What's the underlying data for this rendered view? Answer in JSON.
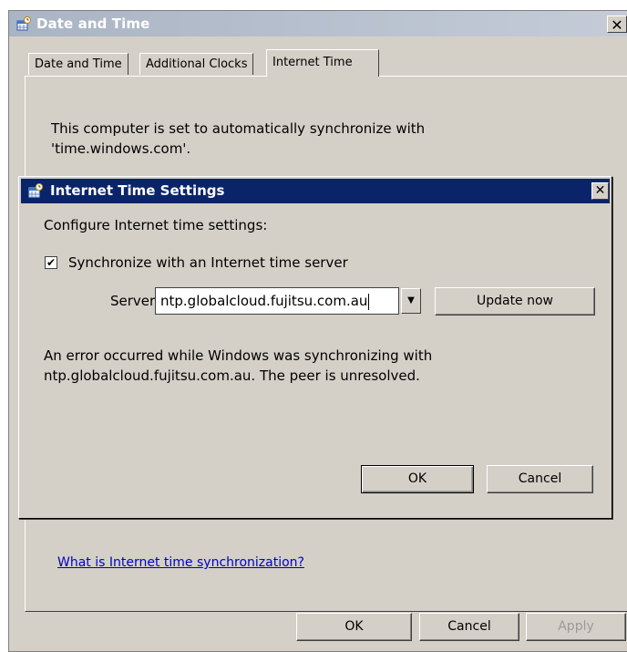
{
  "outer_window": {
    "title": "Date and Time",
    "close_label": "✕",
    "tabs": [
      {
        "label": "Date and Time"
      },
      {
        "label": "Additional Clocks"
      },
      {
        "label": "Internet Time"
      }
    ],
    "sync_status_line1": "This computer is set to automatically synchronize with",
    "sync_status_line2": "'time.windows.com'.",
    "help_link": "What is Internet time synchronization?",
    "ok_label": "OK",
    "cancel_label": "Cancel",
    "apply_label": "Apply"
  },
  "inner_dialog": {
    "title": "Internet Time Settings",
    "close_label": "✕",
    "configure_label": "Configure Internet time settings:",
    "sync_checkbox_label": "Synchronize with an Internet time server",
    "sync_checked": true,
    "server_label": "Server:",
    "server_value": "ntp.globalcloud.fujitsu.com.au",
    "update_now_label": "Update now",
    "error_line1": "An error occurred while Windows was synchronizing with",
    "error_line2": "ntp.globalcloud.fujitsu.com.au.  The peer is unresolved.",
    "ok_label": "OK",
    "cancel_label": "Cancel"
  },
  "icons": {
    "window_icon": "date-time-icon",
    "dropdown_icon": "chevron-down-icon"
  }
}
